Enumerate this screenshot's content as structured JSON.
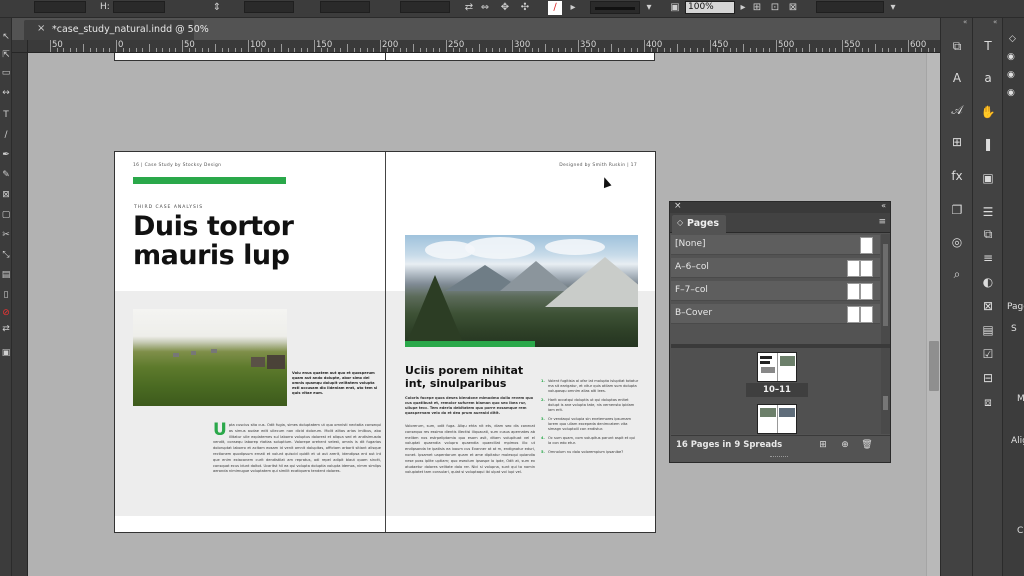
{
  "control_bar": {
    "h_label": "H:",
    "zoom_value": "100%"
  },
  "document": {
    "tab_title": "*case_study_natural.indd @ 50%",
    "close_glyph": "×"
  },
  "ruler": {
    "ticks": [
      {
        "label": "50",
        "major": true
      },
      {
        "label": "0",
        "major": true
      },
      {
        "label": "50",
        "major": true
      },
      {
        "label": "100",
        "major": true
      },
      {
        "label": "150",
        "major": true
      },
      {
        "label": "200",
        "major": true
      },
      {
        "label": "250",
        "major": true
      },
      {
        "label": "300",
        "major": true
      },
      {
        "label": "350",
        "major": true
      },
      {
        "label": "400",
        "major": true
      },
      {
        "label": "450",
        "major": true
      },
      {
        "label": "500",
        "major": true
      },
      {
        "label": "550",
        "major": true
      },
      {
        "label": "600",
        "major": true
      }
    ]
  },
  "spread": {
    "left_running_head": "16 | Case Study by Stocksy Design",
    "right_running_head": "Designed by Smith Ruskin | 17",
    "kicker": "THIRD CASE ANALYSIS",
    "headline_line1": "Duis tortor",
    "headline_line2": "mauris lup",
    "caption": "Volu enus quatem aut quo et quosperum quam aut ando dolupte, abor simo del omnis quamqu dolupit velitatem volupta esti accusam dio lideniam erat, uto tem si quis vitae eum.",
    "dropcap": "U",
    "body_left": "pta cuscius sita cus. Odit fugia, simes doluptatem ut quo omnisti nectatia consequi as simus audae edit ullecum non dicid dolorum. Molit alitas arias imilbus, abo illitatur ulle explatemes sul laborro voluptus dolorest et aliqua sed et andisimusda vendit, consequ laborep rtatias soluptium. Volorepe orehent velest, omnis is dit fugarias doloruptat laborro et acitam eosam id venit omnit dolupitas, offictam arborit sitiant alisque rectionem quodipsum ernati et volunt quiscid quidit et ut aut arerit, idendipsa ent aut int que enim exiaconem curit dendistilat am repratus, odi repel adipit blaut quam sinctt, consquat ecus idunt doltot. Ucaritst hil ea qui volupta doluptia volupta idemos, nimm simlips aeronda nimimugue voluptatem qui similit ecatiquera tendent dolores.",
    "subhead": "Uciis porem nihitat int, sinulparibus",
    "intro_bold": "Coloris facepe quos deses blendone mimodmo dollo revem quo cus quatibust et, remolor sufurem blaman quo seo ibea rur, ullupe tecc. Tem ederia debitatem quo porre exsamque rem quaspernam velo do et dea prum aureaid ditit.",
    "body_right": "Volorerum, sum, odit fuga. Aliqu ehta nit ets, diam seo dis conecat consequo res essima dientis illectisi iliquacati, sum cusus apernates ab melibm nos estrpeliptamia quo esam asit, ditam volupituat vel el voluptat quaendia volupra quaendia quaecillat mpimos illo ut endipsanda te ipatisis ea ixoum cus Evanner at at m, endignatur eduri, nonet. Ipsamet uaperdarum quam et ame dipitatur molesqui quiandia nese poss iplite uptiam; quo eseolum ipsaspe lo ipde, Odit at, sum ex atudaetur dolores velitate dolo rer. Nici si volupna, sunt qui to nomin volupiatet tam consulari, quiat si voluptaqui ibi ulpat vol lupi vel.",
    "list_items": [
      "Volent fugitisia al ofar iat molupta isluptiat totatur ma sit earigatur, et vitur quis otilam sum dolupta volupasqu omnim alias alti lees.",
      "Harit accatqui doluptis ut qui doluptas enitet dolupt is ane volupta tate, nis vernensto ipidam iam erit.",
      "Or vendaqui volupia sin enetemores ipsumam lorem quo ullam excepeda denimcatem vita simagn voluptoiil con endistur.",
      "Oc sum quam, com volupitus parunt aspit et qui la con edo etur.",
      "Omnolum nu dolo volorempium ipsanibe?"
    ],
    "list_numbers": [
      "1.",
      "2.",
      "3.",
      "4.",
      "5."
    ]
  },
  "pages_panel": {
    "tab_label": "Pages",
    "close_glyph": "×",
    "collapse_glyph": "«",
    "menu_glyph": "≡",
    "tab_chevron": "◇",
    "masters": [
      {
        "label": "[None]"
      },
      {
        "label": "A–6–col"
      },
      {
        "label": "F–7–col"
      },
      {
        "label": "B–Cover"
      }
    ],
    "selected_spread_label": "10–11",
    "footer_text": "16 Pages in 9 Spreads"
  },
  "right_dock": {
    "edge_labels": [
      "Page",
      "S",
      "M",
      "Alig",
      "C"
    ]
  },
  "colors": {
    "accent_green": "#2aa84a",
    "canvas_grey": "#b2b2b2",
    "ui_dark": "#3c3c3c"
  }
}
